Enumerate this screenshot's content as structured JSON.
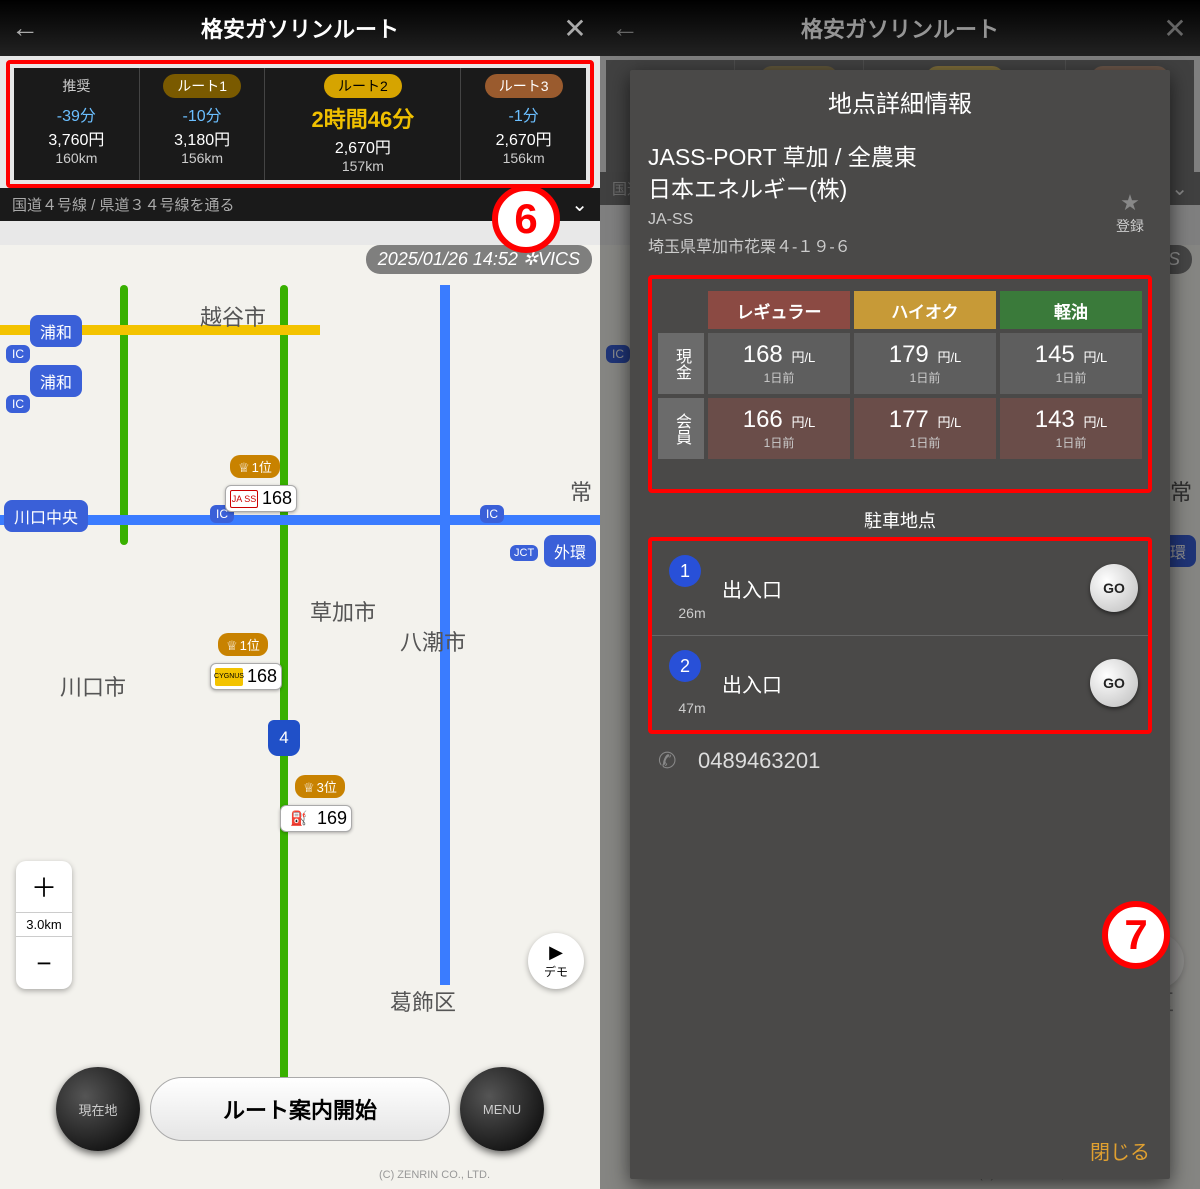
{
  "header": {
    "title": "格安ガソリンルート",
    "back_icon": "←",
    "close_icon": "✕"
  },
  "routes": {
    "cards": [
      {
        "label": "推奨",
        "labelClass": "rec",
        "time": "-39分",
        "timeClass": "neg",
        "price": "3,760円",
        "dist": "160km"
      },
      {
        "label": "ルート1",
        "labelClass": "r1",
        "time": "-10分",
        "timeClass": "neg",
        "price": "3,180円",
        "dist": "156km"
      },
      {
        "label": "ルート2",
        "labelClass": "r2",
        "time": "2時間46分",
        "timeClass": "big",
        "price": "2,670円",
        "dist": "157km"
      },
      {
        "label": "ルート3",
        "labelClass": "r3",
        "time": "-1分",
        "timeClass": "neg",
        "price": "2,670円",
        "dist": "156km"
      }
    ],
    "subText": "国道４号線 / 県道３４号線を通る"
  },
  "vics": "2025/01/26 14:52 ✲VICS",
  "map": {
    "cities": {
      "koshigaya": "越谷市",
      "kawaguchi": "川口市",
      "soka": "草加市",
      "yashio": "八潮市",
      "katsushika": "葛飾区",
      "tokorozawa": "常"
    },
    "ic": {
      "urawa1": "浦和",
      "urawa2": "浦和",
      "kawaguchi": "川口中央",
      "gaikan": "外環"
    },
    "icSmall": "IC",
    "jct": "JCT",
    "prices": {
      "p1": "168",
      "p2": "168",
      "p3": "169"
    },
    "ranks": {
      "r1": "1位",
      "r1b": "1位",
      "r3": "3位"
    },
    "routeNum": "4",
    "brand": {
      "ja": "JA SS",
      "cy": "CYGNUS",
      "gas": "⛽"
    }
  },
  "zoom": {
    "plus": "＋",
    "minus": "−",
    "scale": "3.0km"
  },
  "demo": {
    "icon": "▶",
    "label": "デモ"
  },
  "dials": {
    "left": "現在地",
    "right": "MENU"
  },
  "startLabel": "ルート案内開始",
  "copyright": "(C) ZENRIN CO., LTD.",
  "annotations": {
    "a6": "6",
    "a7": "7"
  },
  "sheet": {
    "title": "地点詳細情報",
    "stationName1": "JASS-PORT 草加 / 全農東",
    "stationName2": "日本エネルギー(株)",
    "fav": {
      "star": "★",
      "label": "登録"
    },
    "brand": "JA-SS",
    "address": "埼玉県草加市花栗４-１９-６",
    "priceHeaders": {
      "reg": "レギュラー",
      "hi": "ハイオク",
      "ds": "軽油"
    },
    "rowHeaders": {
      "cash": "現金",
      "member": "会員"
    },
    "prices": {
      "cash": {
        "reg": "168",
        "hi": "179",
        "ds": "145"
      },
      "member": {
        "reg": "166",
        "hi": "177",
        "ds": "143"
      }
    },
    "unit": "円/L",
    "updated": "1日前",
    "parkTitle": "駐車地点",
    "parkItems": [
      {
        "num": "1",
        "name": "出入口",
        "dist": "26m",
        "go": "GO"
      },
      {
        "num": "2",
        "name": "出入口",
        "dist": "47m",
        "go": "GO"
      }
    ],
    "phone": "0489463201",
    "close": "閉じる"
  }
}
